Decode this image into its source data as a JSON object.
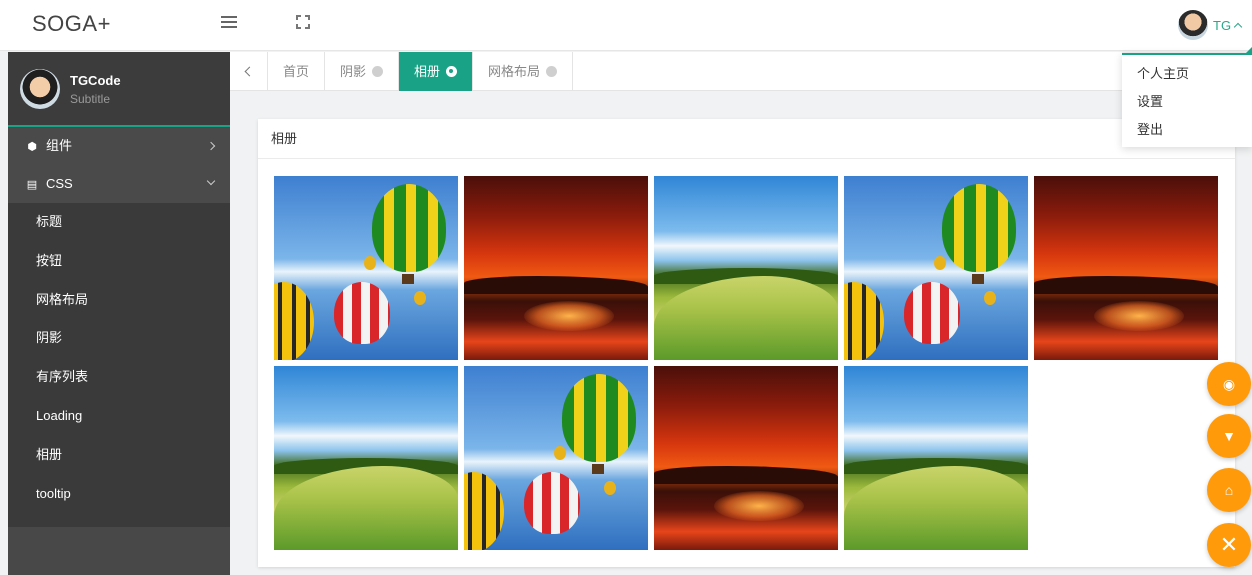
{
  "header": {
    "logo": "SOGA+",
    "user_name": "TG"
  },
  "user_dropdown": {
    "items": [
      "个人主页",
      "设置",
      "登出"
    ]
  },
  "sidebar": {
    "profile": {
      "name": "TGCode",
      "subtitle": "Subtitle"
    },
    "groups": [
      {
        "label": "组件",
        "icon": "cube-icon",
        "expanded": false
      },
      {
        "label": "CSS",
        "icon": "css-icon",
        "expanded": true
      }
    ],
    "sub_items": [
      "标题",
      "按钮",
      "网格布局",
      "阴影",
      "有序列表",
      "Loading",
      "相册",
      "tooltip"
    ]
  },
  "tabs": {
    "items": [
      {
        "label": "首页",
        "closable": false,
        "active": false
      },
      {
        "label": "阴影",
        "closable": true,
        "active": false
      },
      {
        "label": "相册",
        "closable": true,
        "active": true
      },
      {
        "label": "网格布局",
        "closable": true,
        "active": false
      }
    ]
  },
  "card": {
    "title": "相册",
    "photos": [
      "balloons",
      "sunset",
      "field",
      "balloons",
      "sunset",
      "field",
      "balloons",
      "sunset",
      "field"
    ]
  },
  "fabs": [
    {
      "icon": "github-icon"
    },
    {
      "icon": "tshirt-icon"
    },
    {
      "icon": "home-icon"
    },
    {
      "icon": "close-icon"
    }
  ],
  "colors": {
    "accent": "#1aa286",
    "fab": "#ff9a0a",
    "sidebar": "#484848"
  }
}
